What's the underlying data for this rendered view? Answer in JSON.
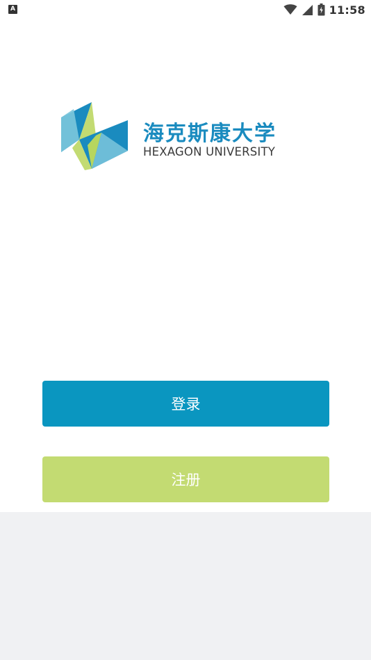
{
  "status_bar": {
    "left_icon": "A",
    "icons": [
      "wifi-icon",
      "signal-icon",
      "battery-icon"
    ],
    "time": "11:58"
  },
  "logo": {
    "cn_name": "海克斯康大学",
    "en_name": "HEXAGON UNIVERSITY",
    "colors": {
      "blue": "#1a8bbf",
      "light_blue": "#7cc6dc",
      "green": "#c3db72"
    }
  },
  "actions": {
    "login_label": "登录",
    "register_label": "注册"
  },
  "colors": {
    "login_button": "#0a96c0",
    "register_button": "#c3db72",
    "bottom_background": "#f0f1f3"
  }
}
